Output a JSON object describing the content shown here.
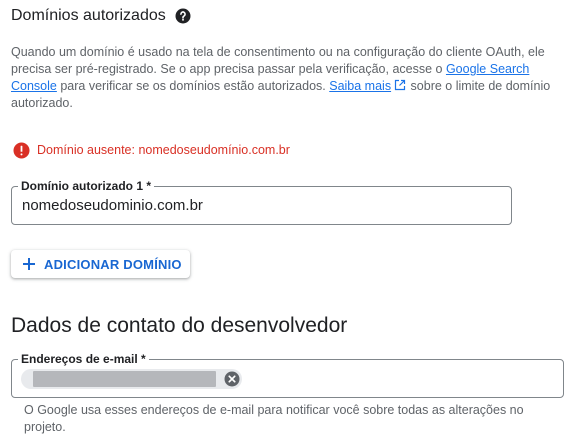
{
  "authorized_domains": {
    "title": "Domínios autorizados",
    "description_part1": "Quando um domínio é usado na tela de consentimento ou na configuração do cliente OAuth, ele precisa ser pré-registrado. Se o app precisa passar pela verificação, acesse o ",
    "search_console_link": "Google Search Console",
    "description_part2": " para verificar se os domínios estão autorizados. ",
    "learn_more_link": "Saiba mais",
    "description_part3": " sobre o limite de domínio autorizado.",
    "error_message": "Domínio ausente: nomedoseudomínio.com.br",
    "domain_field": {
      "label": "Domínio autorizado 1 *",
      "value": "nomedoseudominio.com.br"
    },
    "add_button_label": "ADICIONAR DOMÍNIO"
  },
  "developer_contact": {
    "title": "Dados de contato do desenvolvedor",
    "email_field": {
      "label": "Endereços de e-mail *",
      "chips": [
        "redacted-email"
      ]
    },
    "hint": "O Google usa esses endereços de e-mail para notificar você sobre todas as alterações no projeto."
  },
  "colors": {
    "link": "#1a73e8",
    "error": "#d93025",
    "button_text": "#1967d2",
    "border": "#80868b"
  },
  "icons": [
    "help-icon",
    "external-link-icon",
    "error-icon",
    "plus-icon",
    "remove-chip-icon"
  ]
}
